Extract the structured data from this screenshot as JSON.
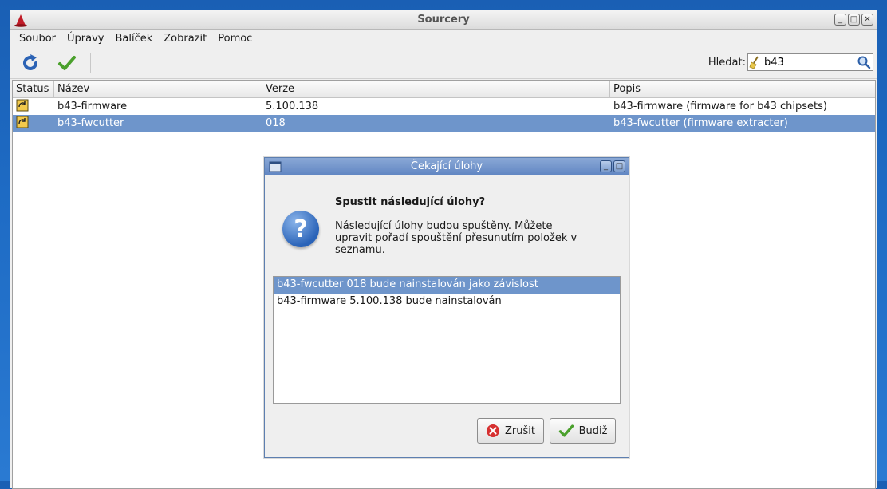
{
  "window": {
    "title": "Sourcery",
    "buttons": {
      "minimize": "_",
      "maximize": "□",
      "close": "✕"
    }
  },
  "menu": [
    {
      "label": "Soubor"
    },
    {
      "label": "Úpravy"
    },
    {
      "label": "Balíček"
    },
    {
      "label": "Zobrazit"
    },
    {
      "label": "Pomoc"
    }
  ],
  "toolbar": {
    "refresh_icon": "refresh-icon",
    "apply_icon": "check-icon",
    "search_label": "Hledat:",
    "search_value": "b43"
  },
  "table": {
    "columns": [
      "Status",
      "Název",
      "Verze",
      "Popis"
    ],
    "rows": [
      {
        "name": "b43-firmware",
        "version": "5.100.138",
        "description": "b43-firmware (firmware for b43 chipsets)"
      },
      {
        "name": "b43-fwcutter",
        "version": "018",
        "description": "b43-fwcutter (firmware extracter)"
      }
    ],
    "selected_row": 1
  },
  "dialog": {
    "title": "Čekající úlohy",
    "heading": "Spustit následující úlohy?",
    "body": "Následující úlohy budou spuštěny. Můžete upravit pořadí spouštění přesunutím položek v seznamu.",
    "tasks": [
      "b43-fwcutter 018 bude nainstalován jako závislost",
      "b43-firmware 5.100.138 bude nainstalován"
    ],
    "cancel_label": "Zrušit",
    "ok_label": "Budiž"
  },
  "colors": {
    "selection": "#6e95cb",
    "dialog_title": "#5f85c2",
    "desktop": "#1e6bc4"
  }
}
